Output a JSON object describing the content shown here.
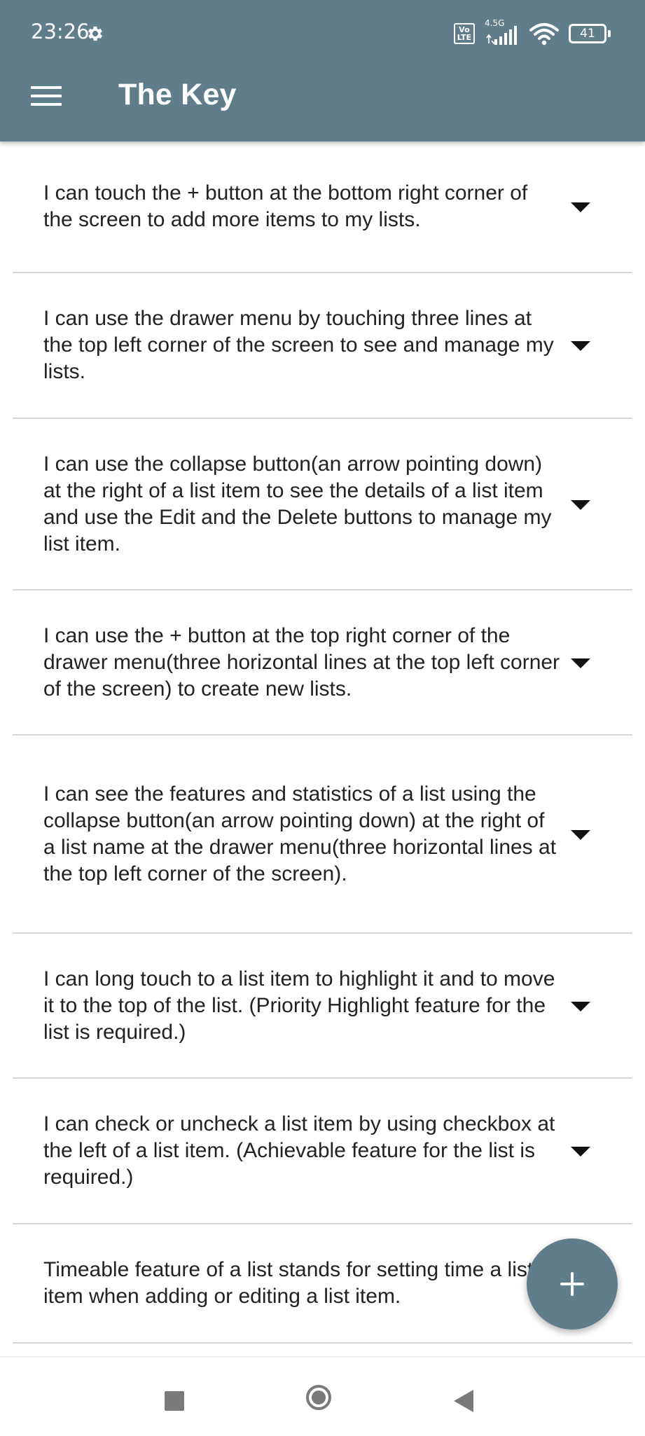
{
  "status_bar": {
    "time": "23:26",
    "volte": "Vo LTE",
    "network": "4.5G",
    "battery": "41"
  },
  "app_bar": {
    "title": "The Key"
  },
  "items": [
    {
      "text": "I can touch the + button at the bottom right corner of the screen to add more items to my lists."
    },
    {
      "text": "I can use the drawer menu by touching three lines at the top left corner of the screen to see and manage my lists."
    },
    {
      "text": "I can use the collapse button(an arrow pointing down) at the right of a list item to see the details of a list item and use the Edit and the Delete buttons to manage my list item."
    },
    {
      "text": "I can use the + button at the top right corner of the drawer menu(three horizontal lines at the top left corner of the screen) to create new lists."
    },
    {
      "text": "I can see the features and statistics of a list using the collapse button(an arrow pointing down) at the right of a list name at the drawer menu(three horizontal lines at the top left corner of the screen)."
    },
    {
      "text": "I can long touch to a list item to highlight it and to move it to the top of the list. (Priority Highlight feature for the list is required.)"
    },
    {
      "text": "I can check or uncheck a list item by using checkbox at the left of a list item. (Achievable feature for the list is required.)"
    },
    {
      "text": "Timeable feature of a list stands for setting time a list item when adding or editing a list item."
    }
  ],
  "colors": {
    "primary": "#607d8b",
    "divider": "#d6d6d6"
  },
  "icons": {
    "menu": "hamburger-menu-icon",
    "expand": "chevron-down-icon",
    "fab": "plus-icon",
    "settings": "gear-icon",
    "wifi": "wifi-icon",
    "signal": "signal-icon",
    "battery": "battery-icon",
    "nav_recents": "square-icon",
    "nav_home": "circle-icon",
    "nav_back": "triangle-back-icon"
  }
}
